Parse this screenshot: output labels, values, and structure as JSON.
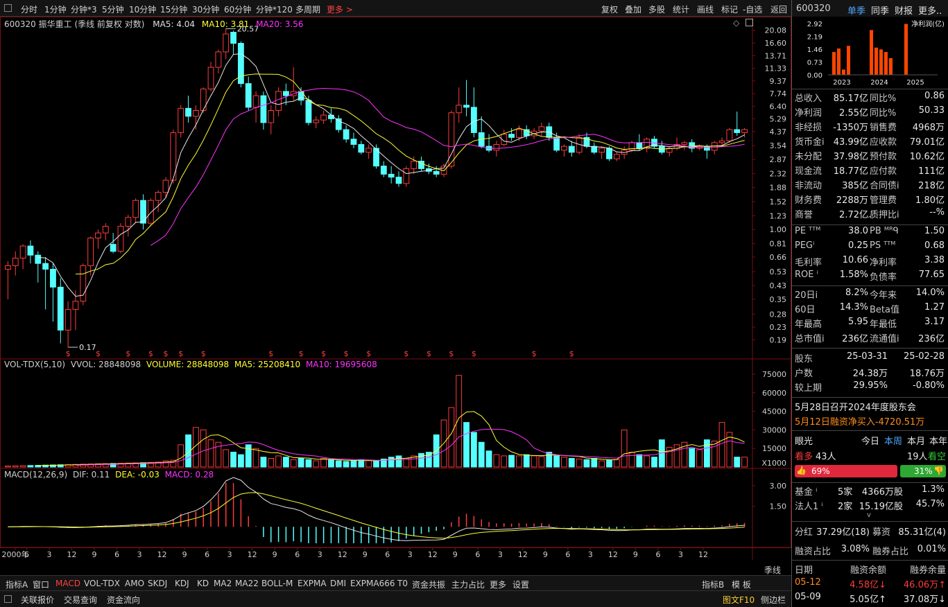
{
  "toolbar": {
    "periods": [
      "分时",
      "1分钟",
      "分钟*3",
      "5分钟",
      "10分钟",
      "15分钟",
      "30分钟",
      "60分钟",
      "分钟*120",
      "多周期"
    ],
    "more": "更多 >",
    "tools": [
      "复权",
      "叠加",
      "多股",
      "统计",
      "画线",
      "标记",
      "-自选",
      "返回"
    ]
  },
  "main_info": {
    "title": "600320 振华重工 (季线 前复权 对数)",
    "ma5": "MA5: 4.04",
    "ma10": "MA10: 3.81",
    "ma20": "MA20: 3.56",
    "high_label": "20.57",
    "low_label": "0.17",
    "price_axis": [
      "20.08",
      "16.60",
      "13.71",
      "11.33",
      "9.37",
      "7.74",
      "6.40",
      "5.29",
      "4.37",
      "3.54",
      "2.87",
      "2.32",
      "1.88",
      "1.52",
      "1.23",
      "1.00",
      "0.81",
      "0.66",
      "0.53",
      "0.43",
      "0.35",
      "0.28",
      "0.23",
      "0.19"
    ],
    "dividend_mark": "$"
  },
  "vol_info": {
    "name": "VOL-TDX(5,10)",
    "vvol": "VVOL: 28848098",
    "volume": "VOLUME: 28848098",
    "ma5": "MA5: 25208410",
    "ma10": "MA10: 19695608",
    "axis": [
      "75000",
      "60000",
      "45000",
      "30000",
      "15000"
    ],
    "unit": "X1000"
  },
  "macd_info": {
    "name": "MACD(12,26,9)",
    "dif": "DIF: 0.11",
    "dea": "DEA: -0.03",
    "macd": "MACD: 0.28",
    "axis": [
      "3.00",
      "1.50"
    ]
  },
  "time_axis": {
    "labels": [
      "2000年",
      "6",
      "3",
      "12",
      "9",
      "6",
      "3",
      "12",
      "9",
      "6",
      "3",
      "12",
      "9",
      "6",
      "3",
      "12",
      "9",
      "6",
      "3",
      "12",
      "9",
      "6",
      "3",
      "12",
      "9",
      "6",
      "3",
      "12",
      "9",
      "6",
      "3",
      "12"
    ],
    "period": "季线"
  },
  "bottom_tabs": [
    "指标A",
    "窗口",
    "MACD",
    "VOL-TDX",
    "AMO",
    "SKDJ",
    "KDJ",
    "KD",
    "MA2",
    "MA22",
    "BOLL-M",
    "EXPMA",
    "DMI",
    "EXPMA666",
    "T0",
    "资金共振",
    "主力占比",
    "更多",
    "设置"
  ],
  "bottom_right": [
    "指标B",
    "模 板"
  ],
  "status": {
    "items": [
      "关联报价",
      "交易查询",
      "资金流向"
    ],
    "right": [
      "图文F10",
      "侧边栏"
    ]
  },
  "right": {
    "code": "600320",
    "tabs": [
      "单季",
      "同季",
      "财报",
      "更多.."
    ],
    "mini_chart": {
      "ylabels": [
        "2.92",
        "2.19",
        "1.46",
        "0.73",
        "0.00"
      ],
      "xlabels": [
        "2023",
        "2024",
        "2025"
      ],
      "legend": "净利润(亿)",
      "values": [
        1.3,
        1.5,
        0.3,
        1.65,
        2.55,
        1.55,
        1.45,
        1.3,
        0.95,
        2.9
      ]
    },
    "fin": [
      [
        "总收入",
        "85.17亿",
        "同比%",
        "0.86"
      ],
      [
        "净利润",
        "2.55亿",
        "同比%",
        "50.33"
      ],
      [
        "非经损",
        "-1350万",
        "销售费",
        "4968万"
      ],
      [
        "货币金i",
        "43.99亿",
        "应收款",
        "79.01亿"
      ],
      [
        "未分配",
        "37.98亿",
        "预付款",
        "10.62亿"
      ],
      [
        "现金流",
        "18.77亿",
        "应付款",
        "111亿"
      ],
      [
        "非流动",
        "385亿",
        "合同债i",
        "218亿"
      ],
      [
        "财务费",
        "2288万",
        "管理费",
        "1.80亿"
      ],
      [
        "商誉",
        "2.72亿",
        "质押比i",
        "--%"
      ]
    ],
    "val": [
      [
        "PE ᵀᵀᴹ",
        "38.0",
        "PB ᴹᴿᑫ",
        "1.50"
      ],
      [
        "PEGⁱ",
        "0.25",
        "PS ᵀᵀᴹ",
        "0.68"
      ],
      [
        "毛利率",
        "10.66",
        "净利率",
        "3.38"
      ],
      [
        "ROE ⁱ",
        "1.58%",
        "负债率",
        "77.65"
      ]
    ],
    "perf": [
      [
        "20日i",
        "8.2%",
        "今年来",
        "14.0%"
      ],
      [
        "60日",
        "14.3%",
        "Beta值",
        "1.27"
      ],
      [
        "年最高",
        "5.95",
        "年最低",
        "3.17"
      ],
      [
        "总市值i",
        "236亿",
        "流通值i",
        "236亿"
      ]
    ],
    "holders": {
      "header": [
        "股东",
        "25-03-31",
        "25-02-28"
      ],
      "rows": [
        [
          "户数",
          "24.38万",
          "18.76万"
        ],
        [
          "较上期",
          "29.95%",
          "-0.80%"
        ]
      ]
    },
    "news1": "5月28日召开2024年度股东会",
    "news2": "5月12日融资净买入-4720.51万",
    "eye": {
      "label": "眼光",
      "tabs": [
        "今日",
        "本周",
        "本月",
        "本年"
      ],
      "bull_label": "看多",
      "bull_count": "43人",
      "bear_count": "19人",
      "bear_label": "看空",
      "bull_pct": "69%",
      "bear_pct": "31%",
      "bull_frac": 0.69
    },
    "inst": [
      [
        "基金 ⁱ",
        "5家",
        "4366万股",
        "1.3%"
      ],
      [
        "法人1 ⁱ",
        "2家",
        "15.19亿股",
        "45.7%"
      ]
    ],
    "div": [
      "分红",
      "37.29亿(18)",
      "募资",
      "85.31亿(4)"
    ],
    "margin_ratio": [
      "融资占比",
      "3.08%",
      "融券占比",
      "0.01%"
    ],
    "margin_table": {
      "header": [
        "日期",
        "融资余额",
        "融券余量"
      ],
      "rows": [
        [
          "05-12",
          "4.58亿↓",
          "46.06万↑"
        ],
        [
          "05-09",
          "5.05亿↑",
          "37.08万↓"
        ]
      ]
    }
  }
}
